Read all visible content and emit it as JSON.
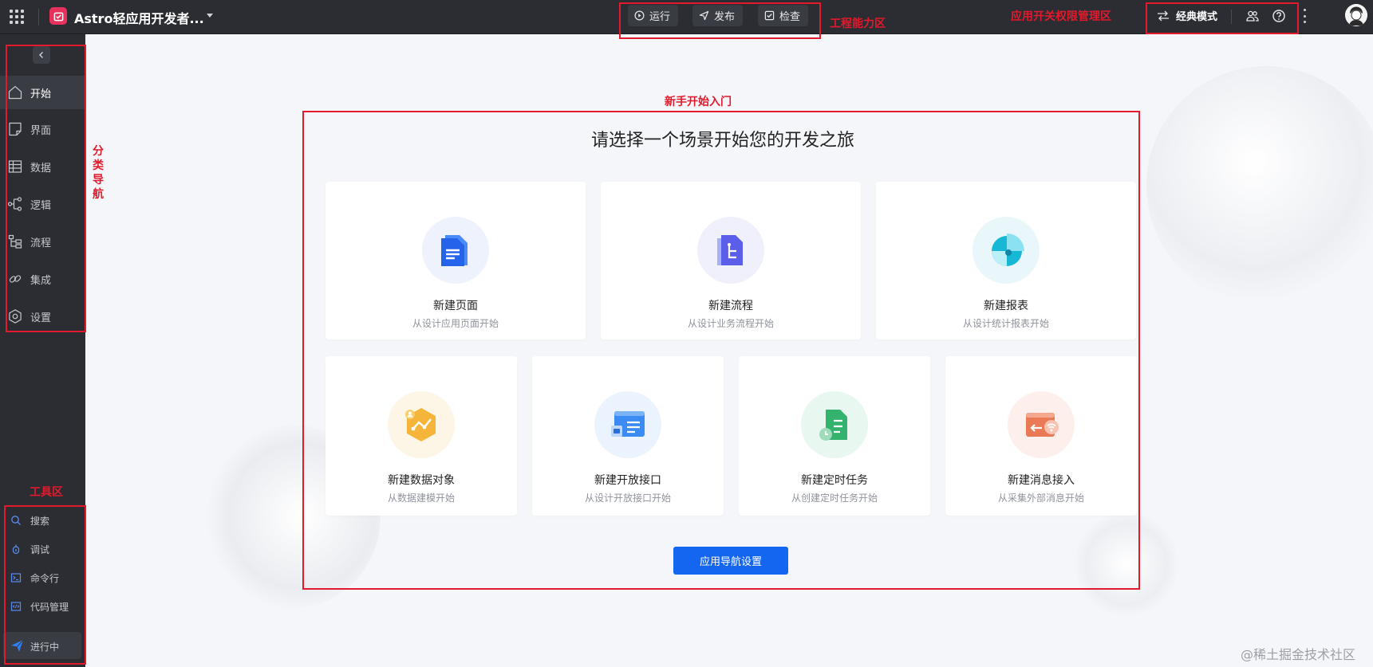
{
  "header": {
    "app_name": "Astro轻应用开发者...",
    "actions": [
      {
        "label": "运行",
        "icon": "play-circle-icon"
      },
      {
        "label": "发布",
        "icon": "send-icon"
      },
      {
        "label": "检查",
        "icon": "check-square-icon"
      }
    ],
    "classic_mode_label": "经典模式",
    "right_icons": [
      "switch-icon",
      "user-group-icon",
      "help-icon",
      "more-vertical-icon",
      "avatar"
    ]
  },
  "sidebar": {
    "nav": [
      {
        "label": "开始",
        "icon": "home-icon",
        "active": true
      },
      {
        "label": "界面",
        "icon": "page-icon",
        "active": false
      },
      {
        "label": "数据",
        "icon": "table-icon",
        "active": false
      },
      {
        "label": "逻辑",
        "icon": "logic-icon",
        "active": false
      },
      {
        "label": "流程",
        "icon": "flow-icon",
        "active": false
      },
      {
        "label": "集成",
        "icon": "link-icon",
        "active": false
      },
      {
        "label": "设置",
        "icon": "settings-icon",
        "active": false
      }
    ],
    "tools": [
      {
        "label": "搜索",
        "icon": "search-icon"
      },
      {
        "label": "调试",
        "icon": "debug-icon"
      },
      {
        "label": "命令行",
        "icon": "terminal-icon"
      },
      {
        "label": "代码管理",
        "icon": "code-icon"
      }
    ],
    "running_label": "进行中"
  },
  "main": {
    "title": "请选择一个场景开始您的开发之旅",
    "cards_row1": [
      {
        "title": "新建页面",
        "subtitle": "从设计应用页面开始",
        "icon": "page-doc-icon"
      },
      {
        "title": "新建流程",
        "subtitle": "从设计业务流程开始",
        "icon": "flow-doc-icon"
      },
      {
        "title": "新建报表",
        "subtitle": "从设计统计报表开始",
        "icon": "report-pie-icon"
      }
    ],
    "cards_row2": [
      {
        "title": "新建数据对象",
        "subtitle": "从数据建模开始",
        "icon": "data-object-icon"
      },
      {
        "title": "新建开放接口",
        "subtitle": "从设计开放接口开始",
        "icon": "open-api-icon"
      },
      {
        "title": "新建定时任务",
        "subtitle": "从创建定时任务开始",
        "icon": "timer-task-icon"
      },
      {
        "title": "新建消息接入",
        "subtitle": "从采集外部消息开始",
        "icon": "message-in-icon"
      }
    ],
    "nav_settings_button": "应用导航设置"
  },
  "annotations": {
    "engineering_area": "工程能力区",
    "app_permission_area": "应用开关权限管理区",
    "newbie_entry": "新手开始入门",
    "category_nav": "分类导航",
    "tool_area": "工具区"
  },
  "watermark": "@稀土掘金技术社区",
  "colors": {
    "topbar_bg": "#2b2d33",
    "accent": "#1466f0",
    "annotation_red": "#e21a2b"
  }
}
